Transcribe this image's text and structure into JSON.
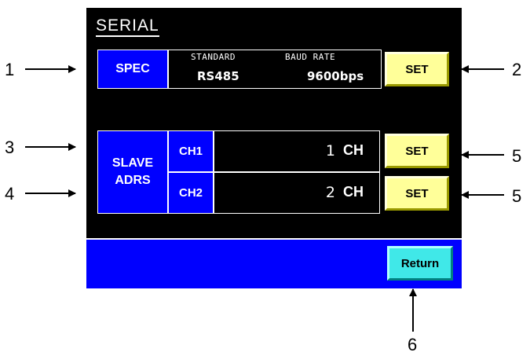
{
  "screen": {
    "title": "SERIAL",
    "spec": {
      "label": "SPEC",
      "standard_header": "STANDARD",
      "baud_header": "BAUD RATE",
      "standard_value": "RS485",
      "baud_value": "9600bps",
      "set_label": "SET"
    },
    "slave": {
      "label_line1": "SLAVE",
      "label_line2": "ADRS",
      "channels": [
        {
          "label": "CH1",
          "number": "1",
          "unit": "CH",
          "set_label": "SET"
        },
        {
          "label": "CH2",
          "number": "2",
          "unit": "CH",
          "set_label": "SET"
        }
      ]
    },
    "return_label": "Return"
  },
  "callouts": {
    "c1": "1",
    "c2": "2",
    "c3": "3",
    "c4": "4",
    "c5a": "5",
    "c5b": "5",
    "c6": "6"
  },
  "colors": {
    "screen_bg": "#000000",
    "label_blue": "#0000ff",
    "set_button": "#ffff99",
    "return_button": "#40e8e8"
  }
}
